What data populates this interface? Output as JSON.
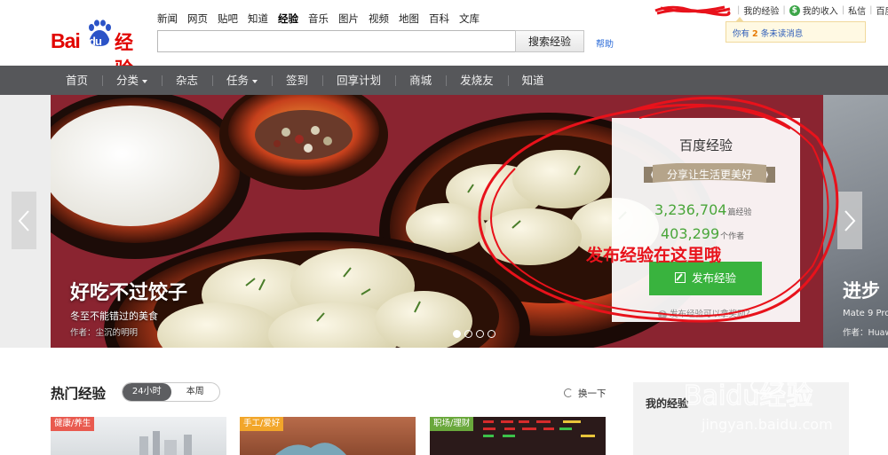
{
  "logo": {
    "bai": "Bai",
    "du": "du",
    "jy": "经验"
  },
  "topnav": [
    "新闻",
    "网页",
    "贴吧",
    "知道",
    "经验",
    "音乐",
    "图片",
    "视频",
    "地图",
    "百科",
    "文库"
  ],
  "topnav_active": "经验",
  "search": {
    "value": "",
    "button_label": "搜索经验",
    "help_label": "帮助"
  },
  "userbar": {
    "my_experience": "我的经验",
    "my_income": "我的收入",
    "private_msg": "私信",
    "baidu": "百度首"
  },
  "notice": {
    "prefix": "你有",
    "count": "2",
    "suffix": "条未读消息"
  },
  "navbar": [
    {
      "label": "首页",
      "has_caret": false
    },
    {
      "label": "分类",
      "has_caret": true
    },
    {
      "label": "杂志",
      "has_caret": false
    },
    {
      "label": "任务",
      "has_caret": true
    },
    {
      "label": "签到",
      "has_caret": false
    },
    {
      "label": "回享计划",
      "has_caret": false
    },
    {
      "label": "商城",
      "has_caret": false
    },
    {
      "label": "发烧友",
      "has_caret": false
    },
    {
      "label": "知道",
      "has_caret": false
    }
  ],
  "slide": {
    "title": "好吃不过饺子",
    "subtitle": "冬至不能错过的美食",
    "author": "作者：尘沉的明明"
  },
  "next_slide": {
    "title": "进步",
    "subtitle": "Mate 9 Pro",
    "author": "作者：Huaw"
  },
  "carousel": {
    "dots": 4,
    "active_dot": 0
  },
  "stats": {
    "title": "百度经验",
    "slogan": "分享让生活更美好",
    "count_articles": "3,236,704",
    "count_articles_unit": "篇经验",
    "count_authors": "403,299",
    "count_authors_unit": "个作者",
    "publish_label": "发布经验",
    "howto_label": "发布经验可以拿奖励？"
  },
  "annotation": "发布经验在这里哦",
  "hot": {
    "title": "热门经验",
    "tabs": [
      "24小时",
      "本周"
    ],
    "active_tab": 0,
    "refresh_label": "换一下",
    "cards": [
      "健康/养生",
      "手工/爱好",
      "职场/理财"
    ]
  },
  "my_box": {
    "title": "我的经验"
  },
  "watermark": {
    "brand": "Baidu经验",
    "url": "jingyan.baidu.com"
  },
  "colors": {
    "brand_red": "#e10601",
    "nav_bg": "#56575a",
    "stats_green": "#4aa63a",
    "publish_green": "#39b33e",
    "annotation_red": "#e8121b"
  }
}
